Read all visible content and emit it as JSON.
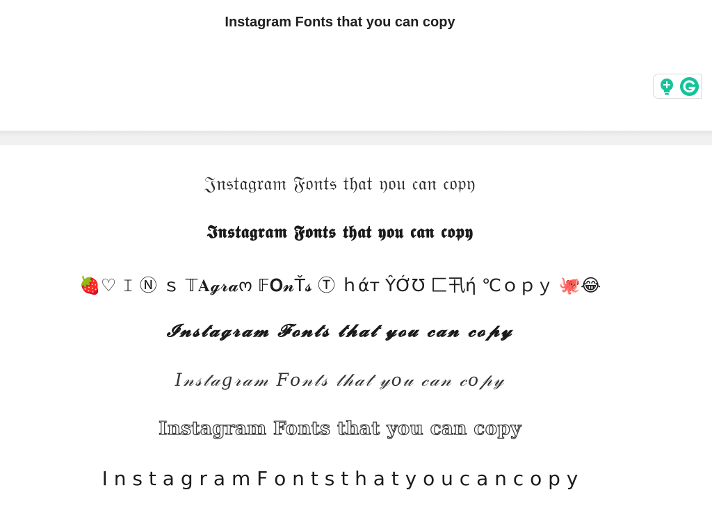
{
  "input": {
    "text": "Instagram Fonts that you can copy"
  },
  "grammarly": {
    "icons": [
      "lightbulb-plus-icon",
      "grammarly-g-icon"
    ],
    "colors": {
      "brand": "#15c39a",
      "dark_green": "#0d8a6a"
    }
  },
  "results": [
    {
      "id": "fraktur",
      "text": "𝔍𝔫𝔰𝔱𝔞𝔤𝔯𝔞𝔪 𝔉𝔬𝔫𝔱𝔰 𝔱𝔥𝔞𝔱 𝔶𝔬𝔲 𝔠𝔞𝔫 𝔠𝔬𝔭𝔶"
    },
    {
      "id": "bold-fraktur",
      "text": "𝕴𝖓𝖘𝖙𝖆𝖌𝖗𝖆𝖒 𝕱𝖔𝖓𝖙𝖘 𝖙𝖍𝖆𝖙 𝖞𝖔𝖚 𝖈𝖆𝖓 𝖈𝖔𝖕𝖞"
    },
    {
      "id": "mixed-decorated",
      "text": "🍓♡  𝙸 Ⓝ ｓ 𝕋𝐀𝓰𝓻𝓪ო 𝔽𝐎𝓷Ť𝓼 Ⓣ ｈάт ŶỚƱ 匚卂ή ℃ｏｐｙ  🐙😂"
    },
    {
      "id": "bold-script",
      "text": "𝓘𝓷𝓼𝓽𝓪𝓰𝓻𝓪𝓶 𝓕𝓸𝓷𝓽𝓼 𝓽𝓱𝓪𝓽 𝔂𝓸𝓾 𝓬𝓪𝓷 𝓬𝓸𝓹𝔂"
    },
    {
      "id": "script",
      "text": "𝐼𝓃𝓈𝓉𝒶𝑔𝓇𝒶𝓂 𝐹𝑜𝓃𝓉𝓈 𝓉𝒽𝒶𝓉 𝓎𝑜𝓊 𝒸𝒶𝓃 𝒸𝑜𝓅𝓎"
    },
    {
      "id": "outline",
      "text": "Instagram Fonts that you can copy"
    },
    {
      "id": "wide-spaced",
      "text": "I n s t a g r a m F o n t s   t h a t   y o u c a n c o p y"
    }
  ]
}
